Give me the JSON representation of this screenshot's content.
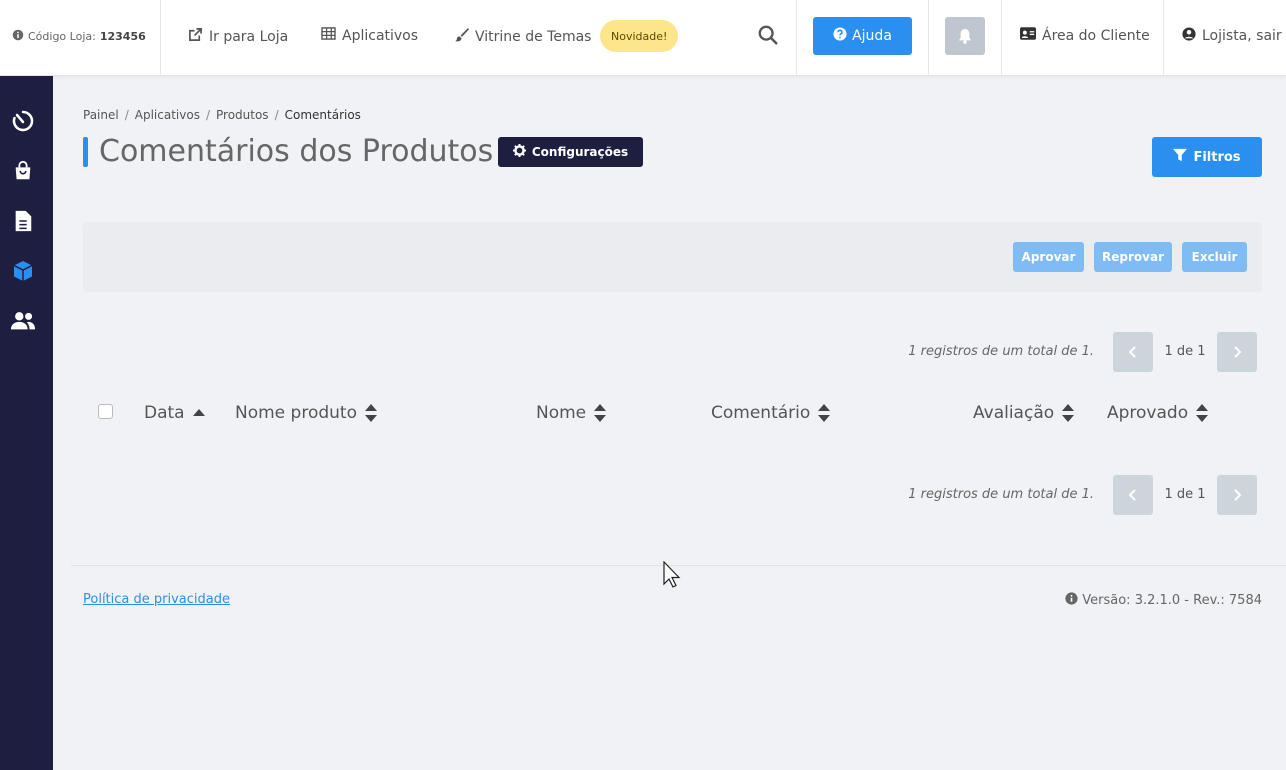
{
  "header": {
    "store_code_label": "Código Loja:",
    "store_code_value": "123456",
    "nav": {
      "store_link": "Ir para Loja",
      "apps_link": "Aplicativos",
      "themes_link": "Vitrine de Temas",
      "new_badge": "Novidade!"
    },
    "help_label": "Ajuda",
    "client_area": "Área do Cliente",
    "user_logout": "Lojista, sair"
  },
  "sidebar": {
    "items": [
      {
        "icon": "dashboard-icon"
      },
      {
        "icon": "shopping-bag-icon"
      },
      {
        "icon": "document-icon"
      },
      {
        "icon": "box-icon"
      },
      {
        "icon": "users-icon"
      }
    ],
    "active_item": "box-icon"
  },
  "breadcrumb": [
    "Painel",
    "Aplicativos",
    "Produtos",
    "Comentários"
  ],
  "page": {
    "title": "Comentários dos Produtos",
    "config_label": "Configurações",
    "filter_label": "Filtros"
  },
  "actions": {
    "approve": "Aprovar",
    "reject": "Reprovar",
    "delete": "Excluir"
  },
  "pagination": {
    "summary": "1 registros de um total de 1.",
    "page_label": "1 de 1"
  },
  "table": {
    "columns": [
      "Data",
      "Nome produto",
      "Nome",
      "Comentário",
      "Avaliação",
      "Aprovado"
    ],
    "rows": []
  },
  "footer": {
    "privacy": "Política de privacidade",
    "version": "Versão: 3.2.1.0 - Rev.: 7584"
  },
  "colors": {
    "primary": "#2b8ff0",
    "sidebar": "#1e1f40",
    "badge": "#fde68a",
    "disabled_button": "#7fbcf5",
    "background": "#f1f2f6"
  }
}
